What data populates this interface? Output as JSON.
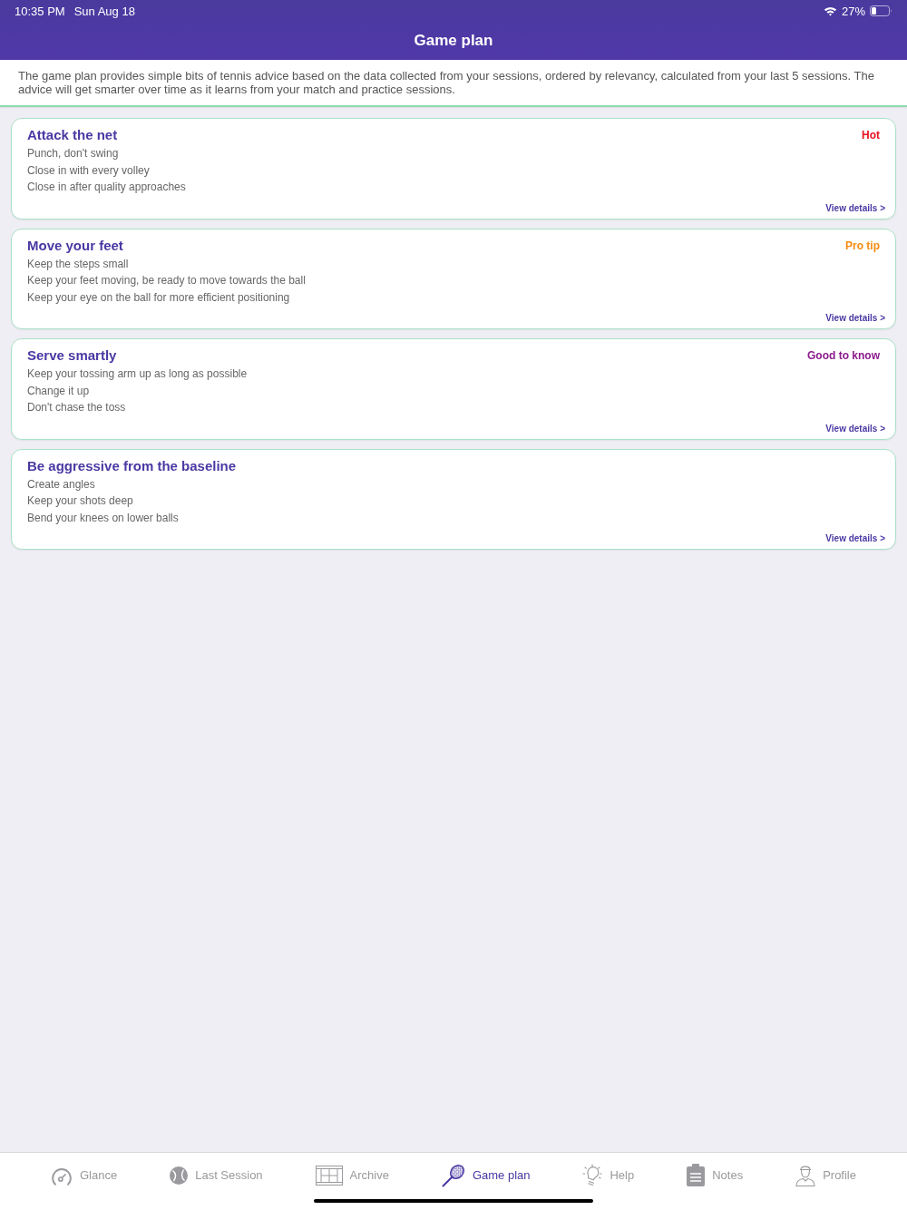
{
  "status_bar": {
    "time": "10:35 PM",
    "date": "Sun Aug 18",
    "battery": "27%"
  },
  "header": {
    "title": "Game plan"
  },
  "intro": "The game plan provides simple bits of tennis advice based on the data collected from your sessions, ordered by relevancy, calculated from your last 5 sessions. The advice will get smarter over time as it learns from your match and practice sessions.",
  "cards": [
    {
      "title": "Attack the net",
      "tag": {
        "label": "Hot",
        "color": "#e8141e"
      },
      "tips": [
        "Punch, don't swing",
        "Close in with every volley",
        "Close in after quality approaches"
      ],
      "link": "View details >"
    },
    {
      "title": "Move your feet",
      "tag": {
        "label": "Pro tip",
        "color": "#f58a12"
      },
      "tips": [
        "Keep the steps small",
        "Keep your feet moving, be ready to move towards the ball",
        "Keep your eye on the ball for more efficient positioning"
      ],
      "link": "View details >"
    },
    {
      "title": "Serve smartly",
      "tag": {
        "label": "Good to know",
        "color": "#8b1a8c"
      },
      "tips": [
        "Keep your tossing arm up as long as possible",
        "Change it up",
        "Don't chase the toss"
      ],
      "link": "View details >"
    },
    {
      "title": "Be aggressive from the baseline",
      "tips": [
        "Create angles",
        "Keep your shots deep",
        "Bend your knees on lower balls"
      ],
      "link": "View details >"
    }
  ],
  "tab_bar": [
    {
      "label": "Glance",
      "selected": false
    },
    {
      "label": "Last Session",
      "selected": false
    },
    {
      "label": "Archive",
      "selected": false
    },
    {
      "label": "Game plan",
      "selected": true
    },
    {
      "label": "Help",
      "selected": false
    },
    {
      "label": "Notes",
      "selected": false
    },
    {
      "label": "Profile",
      "selected": false
    }
  ]
}
